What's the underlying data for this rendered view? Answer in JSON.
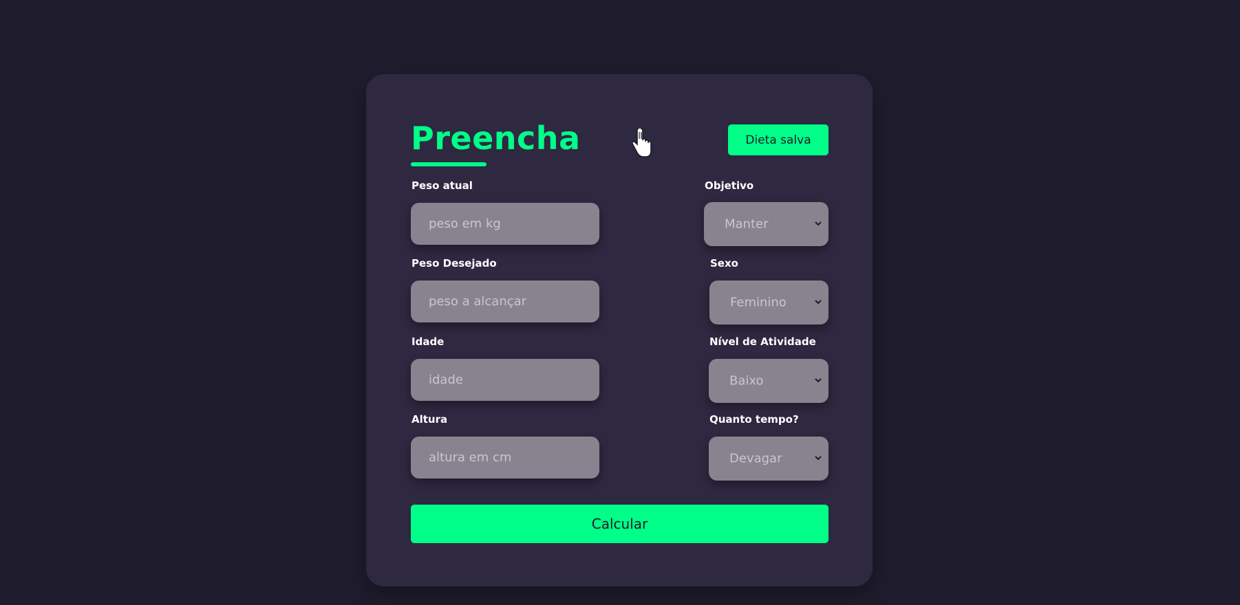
{
  "form": {
    "title": "Preencha",
    "saved_button": "Dieta salva",
    "calculate_button": "Calcular",
    "fields": {
      "peso_atual": {
        "label": "Peso atual",
        "placeholder": "peso em kg"
      },
      "peso_desejado": {
        "label": "Peso Desejado",
        "placeholder": "peso a alcançar"
      },
      "idade": {
        "label": "Idade",
        "placeholder": "idade"
      },
      "altura": {
        "label": "Altura",
        "placeholder": "altura em cm"
      }
    },
    "selects": {
      "objetivo": {
        "label": "Objetivo",
        "value": "Manter"
      },
      "sexo": {
        "label": "Sexo",
        "value": "Feminino"
      },
      "nivel_atividade": {
        "label": "Nível de Atividade",
        "value": "Baixo"
      },
      "quanto_tempo": {
        "label": "Quanto tempo?",
        "value": "Devagar"
      }
    }
  },
  "icons": {
    "cursor": "hand-pointer-icon",
    "dropdown": "chevron-down-icon"
  },
  "colors": {
    "background": "#1f1d2d",
    "card": "#2f2841",
    "accent": "#00ff88",
    "field": "#878490",
    "placeholder": "#c8c6ce"
  }
}
